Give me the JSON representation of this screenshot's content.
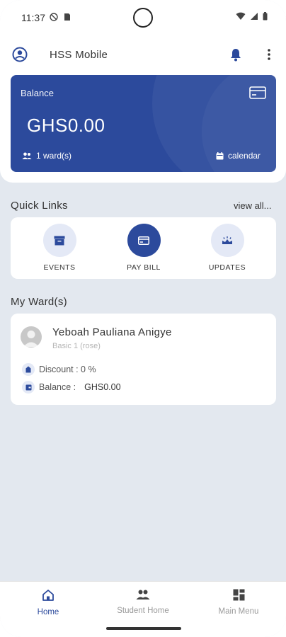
{
  "status_bar": {
    "time": "11:37"
  },
  "app_bar": {
    "title": "HSS Mobile"
  },
  "balance_card": {
    "label": "Balance",
    "amount": "GHS0.00",
    "wards": "1 ward(s)",
    "calendar": "calendar"
  },
  "quick_links": {
    "title": "Quick Links",
    "view_all": "view all...",
    "items": [
      {
        "label": "EVENTS",
        "icon": "archive-box-icon"
      },
      {
        "label": "PAY BILL",
        "icon": "credit-card-icon"
      },
      {
        "label": "UPDATES",
        "icon": "crown-icon"
      }
    ]
  },
  "my_wards": {
    "title": "My Ward(s)",
    "ward": {
      "name": "Yeboah Pauliana Anigye",
      "class": "Basic 1 (rose)",
      "discount_label": "Discount : 0 %",
      "balance_label": "Balance :",
      "balance_value": "GHS0.00"
    }
  },
  "bottom_nav": {
    "items": [
      {
        "label": "Home",
        "icon": "home-icon"
      },
      {
        "label": "Student Home",
        "icon": "people-icon"
      },
      {
        "label": "Main Menu",
        "icon": "dashboard-icon"
      }
    ]
  },
  "colors": {
    "primary": "#2c4a9c",
    "nav_active": "#2c4a9c",
    "background": "#e3e8ef"
  }
}
